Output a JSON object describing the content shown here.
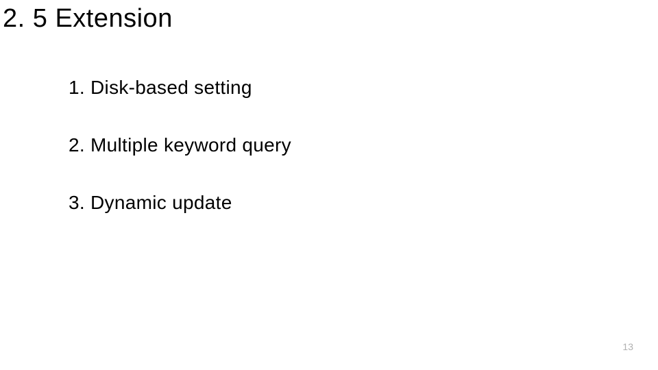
{
  "title": "2. 5 Extension",
  "items": [
    "1. Disk-based setting",
    "2. Multiple keyword query",
    "3. Dynamic update"
  ],
  "page_number": "13"
}
